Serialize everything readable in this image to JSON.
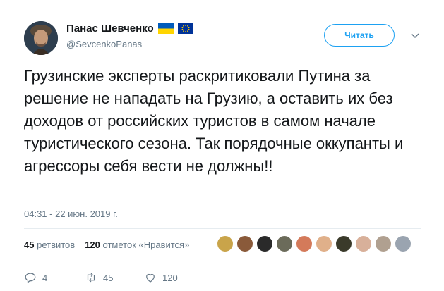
{
  "author": {
    "name": "Панас Шевченко",
    "handle": "@SevcenkoPanas"
  },
  "follow_label": "Читать",
  "tweet_text": "Грузинские эксперты раскритиковали Путина за решение не нападать на Грузию, а оставить их без доходов от российских туристов в самом начале туристического сезона. Так порядочные оккупанты и агрессоры себя вести не должны!!",
  "timestamp": "04:31 - 22 июн. 2019 г.",
  "stats": {
    "retweets_count": "45",
    "retweets_label": "ретвитов",
    "likes_count": "120",
    "likes_label": "отметок «Нравится»"
  },
  "actions": {
    "replies": "4",
    "retweets": "45",
    "likes": "120"
  },
  "colors": {
    "accent": "#1da1f2",
    "muted": "#657786",
    "text": "#14171a"
  },
  "likers": [
    "#c9a44a",
    "#8a5a3a",
    "#2a2a2a",
    "#6b6b5a",
    "#d47a5a",
    "#e0b08a",
    "#3a3a2a",
    "#d8b09a",
    "#b0a090",
    "#9aa4b0"
  ]
}
